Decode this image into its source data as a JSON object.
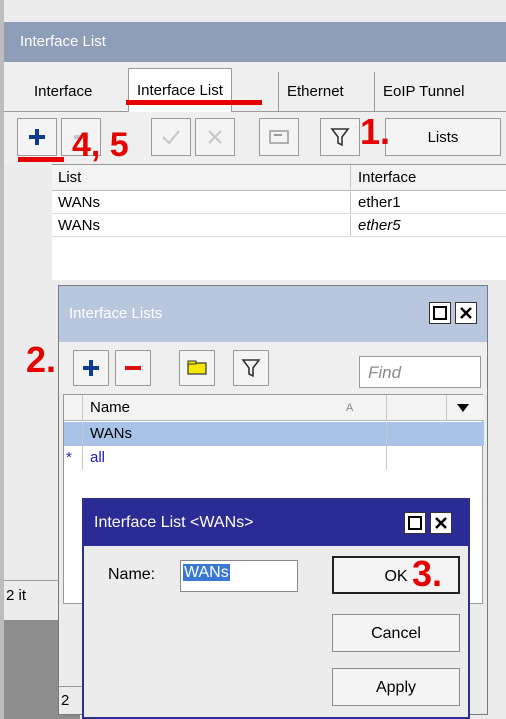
{
  "main": {
    "title": "Interface List",
    "tabs": [
      "Interface",
      "Interface List",
      "Ethernet",
      "EoIP Tunnel"
    ],
    "lists_button": "Lists",
    "table": {
      "headers": [
        "List",
        "Interface"
      ],
      "rows": [
        {
          "list": "WANs",
          "interface": "ether1"
        },
        {
          "list": "WANs",
          "interface": "ether5"
        }
      ]
    },
    "status": "2 it",
    "status2": "2"
  },
  "annotations": {
    "step1": "1.",
    "step2": "2.",
    "step3": "3.",
    "step45": "4, 5"
  },
  "lists_window": {
    "title": "Interface Lists",
    "find_placeholder": "Find",
    "headers": [
      "Name",
      "A"
    ],
    "rows": [
      {
        "marker": "",
        "name": "WANs"
      },
      {
        "marker": "*",
        "name": "all"
      }
    ]
  },
  "dialog": {
    "title": "Interface List <WANs>",
    "name_label": "Name:",
    "name_value": "WANs",
    "ok": "OK",
    "cancel": "Cancel",
    "apply": "Apply"
  },
  "colors": {
    "accent_red": "#e60000",
    "selected_row": "#a9c2e8",
    "dialog_title": "#2b2b95"
  }
}
